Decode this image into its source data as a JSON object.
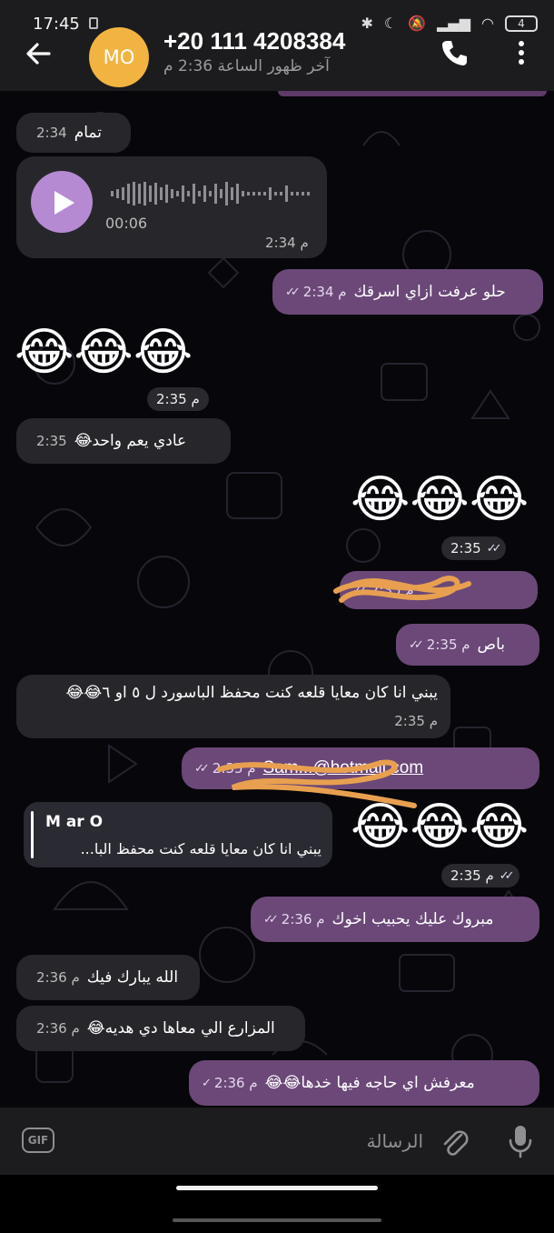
{
  "status_bar": {
    "time": "17:45",
    "battery": "4"
  },
  "header": {
    "avatar_initials": "MO",
    "contact_name": "+20 111 4208384",
    "last_seen": "آخر ظهور الساعة 2:36 م"
  },
  "messages": {
    "m1": {
      "text": "تمام",
      "time": "2:34"
    },
    "voice": {
      "duration": "00:06",
      "time": "2:34 م"
    },
    "m2": {
      "text": "حلو عرفت ازاي اسرقك",
      "time": "2:34 م"
    },
    "emoji1": {
      "emoji": "😂😂😂",
      "time": "2:35 م"
    },
    "m3": {
      "text": "عادي يعم واحد😂",
      "time": "2:35"
    },
    "emoji2": {
      "emoji": "😂😂😂",
      "time": "2:35"
    },
    "m4": {
      "time": "2:35 م"
    },
    "m5": {
      "text": "باص",
      "time": "2:35 م"
    },
    "m6": {
      "text": "يبني انا كان معايا قلعه كنت محفظ الباسورد ل ٥ او ٦😂😂",
      "time": "2:35 م"
    },
    "m7": {
      "link_text": "Sam...@hotmail.com",
      "time": "2:35 م"
    },
    "reply": {
      "name": "M ar O",
      "text": "يبني انا كان معايا قلعه كنت محفظ البا..."
    },
    "emoji3": {
      "emoji": "😂😂😂",
      "time": "2:35 م"
    },
    "m8": {
      "text": "مبروك عليك يحبيب اخوك",
      "time": "2:36 م"
    },
    "m9": {
      "text": "الله يبارك فيك",
      "time": "2:36 م"
    },
    "m10": {
      "text": "المزارع الي معاها دي هديه😂",
      "time": "2:36 م"
    },
    "m11": {
      "text": "معرفش اي حاجه فيها خدها😂😂",
      "time": "2:36 م"
    }
  },
  "input": {
    "placeholder": "الرسالة",
    "gif_label": "GIF"
  },
  "colors": {
    "outgoing": "#6b4878",
    "incoming": "#27272b",
    "avatar": "#f2b441",
    "play_button": "#b58ad3"
  }
}
